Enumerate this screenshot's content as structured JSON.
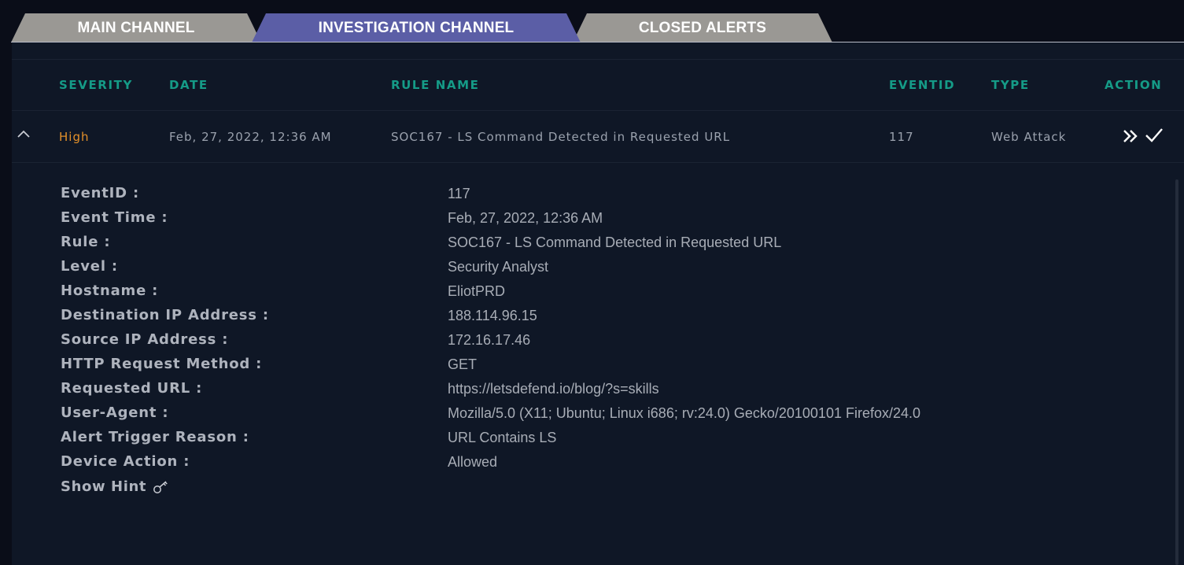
{
  "tabs": [
    {
      "label": "MAIN CHANNEL"
    },
    {
      "label": "INVESTIGATION CHANNEL"
    },
    {
      "label": "CLOSED ALERTS"
    }
  ],
  "table": {
    "headers": {
      "severity": "SEVERITY",
      "date": "DATE",
      "rule_name": "RULE NAME",
      "eventid": "EVENTID",
      "type": "TYPE",
      "action": "ACTION"
    },
    "row": {
      "severity": "High",
      "date": "Feb, 27, 2022, 12:36 AM",
      "rule_name": "SOC167 - LS Command Detected in Requested URL",
      "eventid": "117",
      "type": "Web Attack"
    }
  },
  "details": [
    {
      "label": "EventID :",
      "value": "117"
    },
    {
      "label": "Event Time :",
      "value": "Feb, 27, 2022, 12:36 AM"
    },
    {
      "label": "Rule :",
      "value": "SOC167 - LS Command Detected in Requested URL"
    },
    {
      "label": "Level :",
      "value": "Security Analyst"
    },
    {
      "label": "Hostname :",
      "value": "EliotPRD"
    },
    {
      "label": "Destination IP Address :",
      "value": "188.114.96.15"
    },
    {
      "label": "Source IP Address :",
      "value": "172.16.17.46"
    },
    {
      "label": "HTTP Request Method :",
      "value": "GET"
    },
    {
      "label": "Requested URL :",
      "value": "https://letsdefend.io/blog/?s=skills"
    },
    {
      "label": "User-Agent :",
      "value": "Mozilla/5.0 (X11; Ubuntu; Linux i686; rv:24.0) Gecko/20100101 Firefox/24.0"
    },
    {
      "label": "Alert Trigger Reason :",
      "value": "URL Contains LS"
    },
    {
      "label": "Device Action :",
      "value": "Allowed"
    }
  ],
  "hint": {
    "label": "Show Hint",
    "icon": "key-icon"
  },
  "icons": {
    "collapse": "chevron-up-icon",
    "forward": "double-chevron-right-icon",
    "close_alert": "checkmark-icon"
  },
  "colors": {
    "accent_teal": "#159b87",
    "severity_high": "#e3902a",
    "active_tab": "#5b5ea6",
    "inactive_tab": "#9a9894"
  }
}
